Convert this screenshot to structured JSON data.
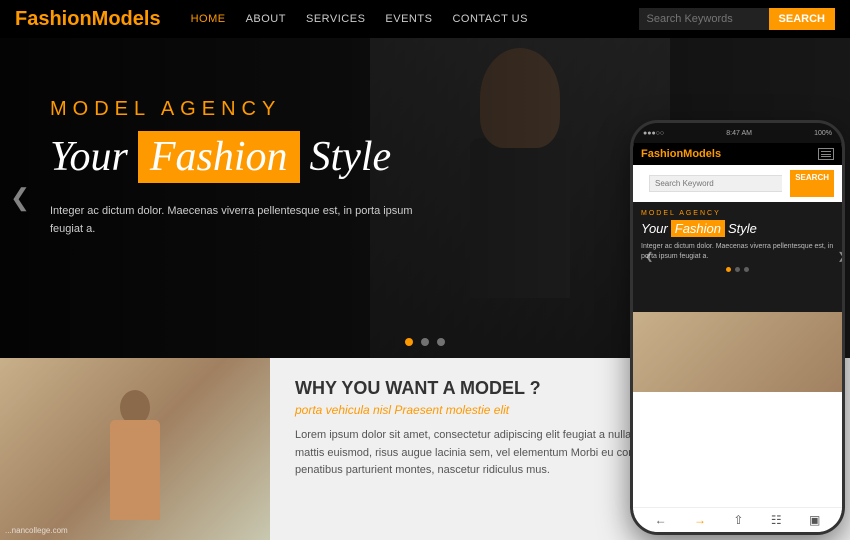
{
  "header": {
    "logo_white": "Fashion",
    "logo_orange": "Models",
    "nav": [
      {
        "label": "HOME",
        "active": true
      },
      {
        "label": "ABOUT",
        "active": false
      },
      {
        "label": "SERVICES",
        "active": false
      },
      {
        "label": "EVENTS",
        "active": false
      },
      {
        "label": "CONTACT US",
        "active": false
      }
    ],
    "search_placeholder": "Search Keywords",
    "search_btn": "SEARCH"
  },
  "hero": {
    "subtitle": "MODEL AGENCY",
    "title_part1": "Your",
    "title_highlight": "Fashion",
    "title_part2": "Style",
    "description": "Integer ac dictum dolor. Maecenas viverra pellentesque est, in porta ipsum feugiat a.",
    "dots": [
      {
        "active": true
      },
      {
        "active": false
      },
      {
        "active": false
      }
    ]
  },
  "bottom": {
    "section_title": "WHY YOU WANT A MODEL ?",
    "section_italic": "porta vehicula nisl Praesent molestie elit",
    "section_body": "Lorem ipsum dolor sit amet, consectetur adipiscing elit feugiat a nulla euismod, porta vehicula nisl. Praesent mattis euismod, risus augue lacinia sem, vel elementum Morbi eu condimentum nibh. Cum sociis natoque penatibus parturient montes, nascetur ridiculus mus.",
    "watermark": "...nancollege.com"
  },
  "phone": {
    "time": "8:47 AM",
    "battery": "100%",
    "logo_white": "Fashion",
    "logo_orange": "Models",
    "search_placeholder": "Search Keyword",
    "search_btn": "SEARCH",
    "hero_subtitle": "MODEL AGENCY",
    "hero_title1": "Your",
    "hero_highlight": "Fashion",
    "hero_title2": "Style",
    "hero_desc": "Integer ac dictum dolor. Maecenas viverra pellentesque est, in porta ipsum feugiat a.",
    "bottom_icons": [
      "←",
      "→",
      "↑",
      "⊞",
      "⊡"
    ]
  }
}
